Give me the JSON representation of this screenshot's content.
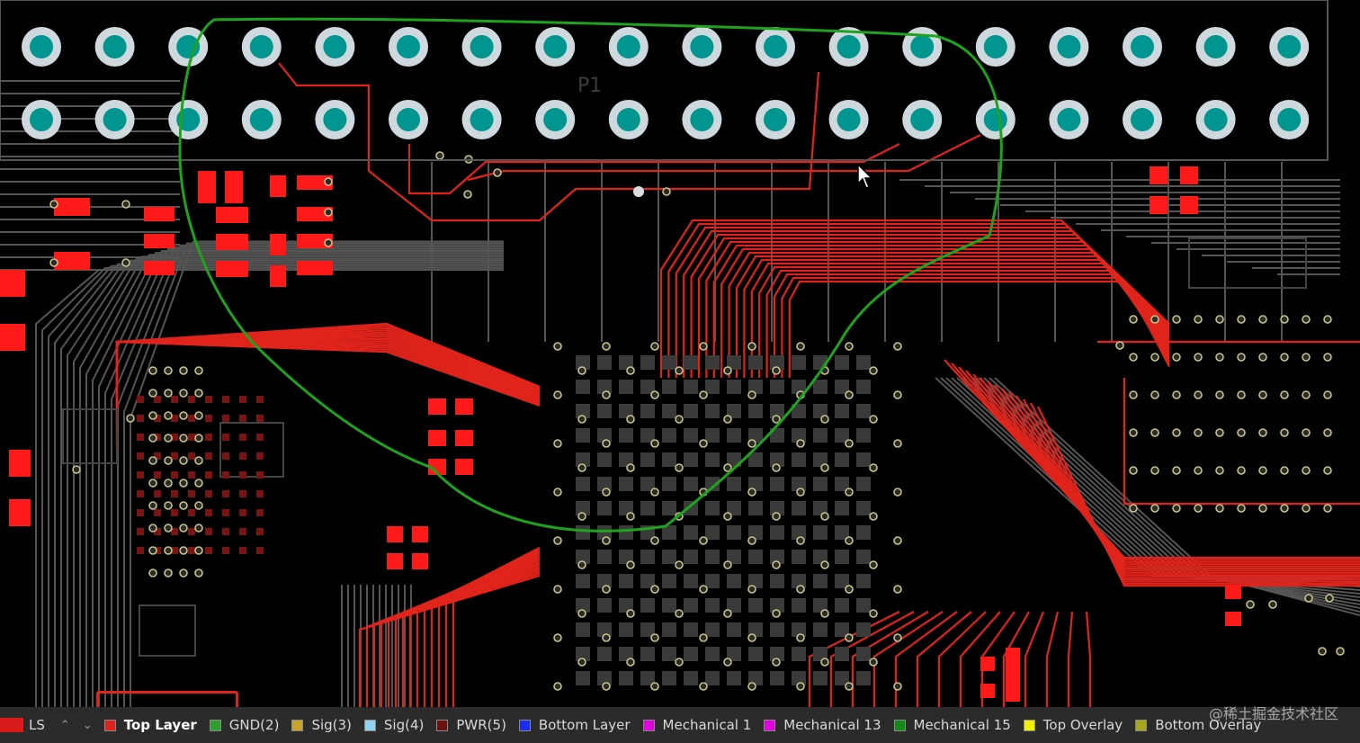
{
  "board": {
    "designator": "P1",
    "trace_color": "#e0241c",
    "pad_fill": "#ff1a1a",
    "via_color": "#c8c48a",
    "header_pad_outer": "#cfd8dc",
    "header_pad_inner": "#00968f",
    "outline_color": "#555555",
    "annotation_color": "#1fa31f"
  },
  "layer_bar": {
    "ls_label": "LS",
    "ls_color": "#d91a1a",
    "tabs": [
      {
        "label": "Top Layer",
        "color": "#e0241c",
        "active": true
      },
      {
        "label": "GND(2)",
        "color": "#2e9e2e"
      },
      {
        "label": "Sig(3)",
        "color": "#c9a227"
      },
      {
        "label": "Sig(4)",
        "color": "#8fd3f0"
      },
      {
        "label": "PWR(5)",
        "color": "#6e1010"
      },
      {
        "label": "Bottom Layer",
        "color": "#1b2cf0"
      },
      {
        "label": "Mechanical 1",
        "color": "#e000e0"
      },
      {
        "label": "Mechanical 13",
        "color": "#e000e0"
      },
      {
        "label": "Mechanical 15",
        "color": "#138a13"
      },
      {
        "label": "Top Overlay",
        "color": "#f0f000"
      },
      {
        "label": "Bottom Overlay",
        "color": "#a8a820"
      }
    ]
  },
  "watermark": "@稀土掘金技术社区"
}
